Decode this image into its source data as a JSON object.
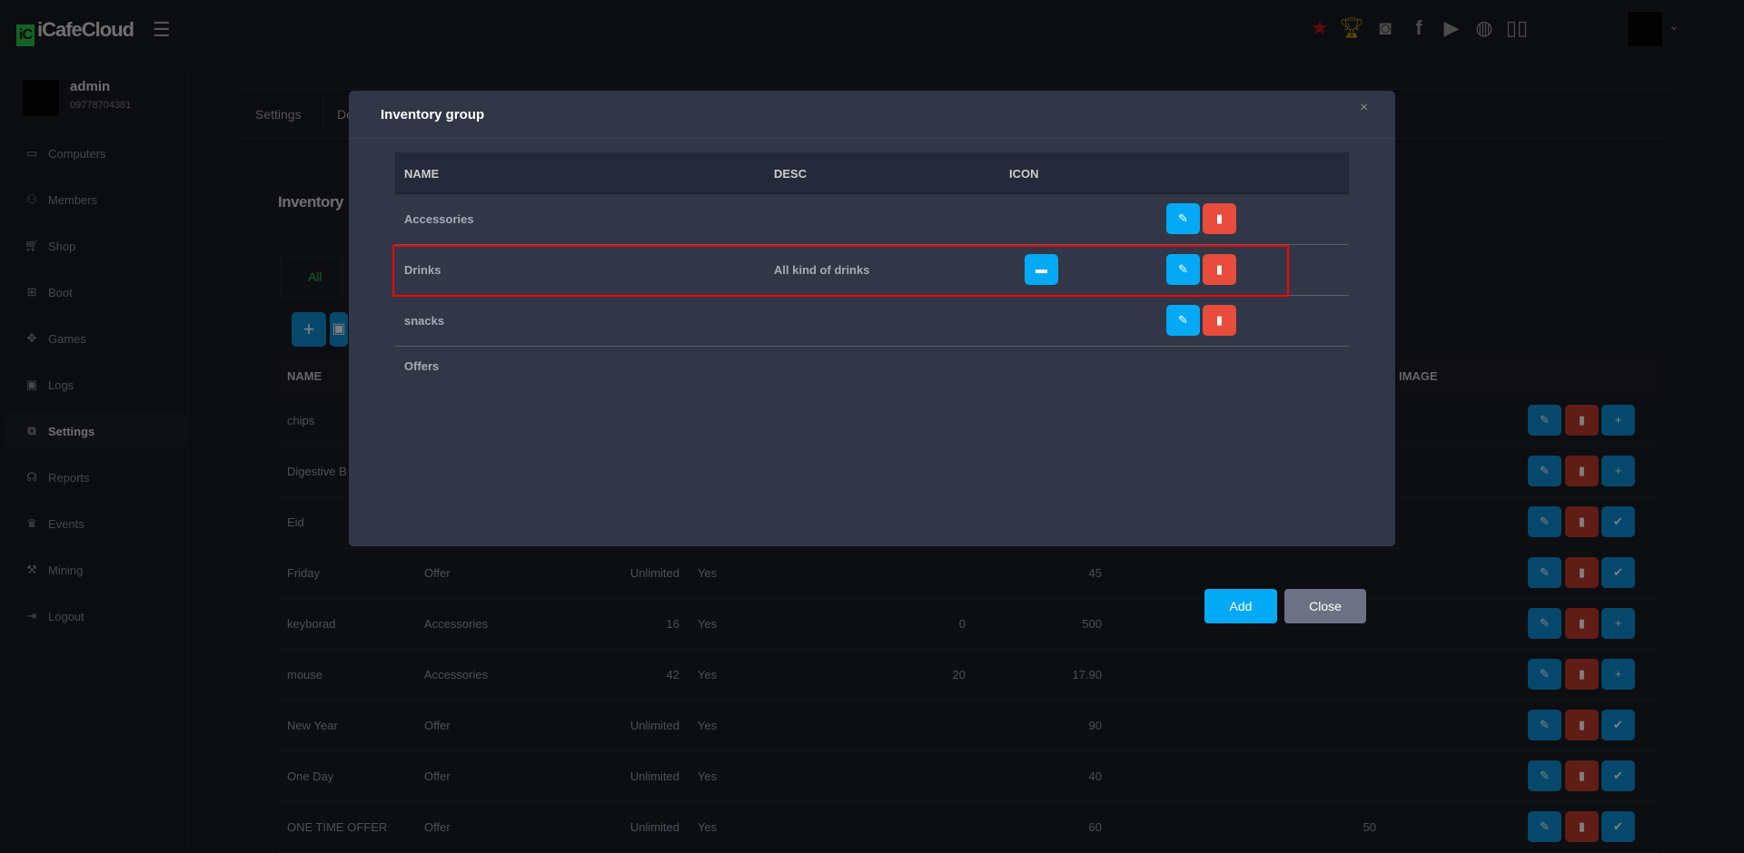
{
  "app": {
    "logo": "iCafeCloud",
    "logo_mark": "iC"
  },
  "topbar": {
    "icons": [
      "ranking-icon",
      "trophy-icon",
      "discord-icon",
      "facebook-icon",
      "youtube-icon",
      "globe-icon",
      "book-icon"
    ]
  },
  "user": {
    "name": "admin",
    "phone": "09778704381"
  },
  "sidebar": {
    "items": [
      {
        "label": "Computers",
        "icon": "monitor-icon"
      },
      {
        "label": "Members",
        "icon": "users-icon"
      },
      {
        "label": "Shop",
        "icon": "cart-icon"
      },
      {
        "label": "Boot",
        "icon": "windows-icon"
      },
      {
        "label": "Games",
        "icon": "gamepad-icon"
      },
      {
        "label": "Logs",
        "icon": "calendar-icon"
      },
      {
        "label": "Settings",
        "icon": "settings-icon",
        "active": true
      },
      {
        "label": "Reports",
        "icon": "reports-icon"
      },
      {
        "label": "Events",
        "icon": "crown-icon"
      },
      {
        "label": "Mining",
        "icon": "pickaxe-icon"
      },
      {
        "label": "Logout",
        "icon": "logout-icon"
      }
    ]
  },
  "page": {
    "tabs": [
      "Settings",
      "De"
    ],
    "title": "Inventory",
    "filter_tab": "All",
    "table": {
      "headers": {
        "name": "NAME",
        "image": "IMAGE"
      },
      "rows": [
        {
          "name": "chips",
          "action": "+"
        },
        {
          "name": "Digestive B",
          "action": "+"
        },
        {
          "name": "Eid",
          "action": "✔"
        },
        {
          "name": "Friday",
          "group": "Offer",
          "qty": "Unlimited",
          "active": "Yes",
          "cost": "",
          "price": "45",
          "extra": "",
          "action": "✔"
        },
        {
          "name": "keyborad",
          "group": "Accessories",
          "qty": "16",
          "active": "Yes",
          "cost": "0",
          "price": "500",
          "extra": "",
          "action": "+"
        },
        {
          "name": "mouse",
          "group": "Accessories",
          "qty": "42",
          "active": "Yes",
          "cost": "20",
          "price": "17.90",
          "extra": "",
          "action": "+"
        },
        {
          "name": "New Year",
          "group": "Offer",
          "qty": "Unlimited",
          "active": "Yes",
          "cost": "",
          "price": "90",
          "extra": "",
          "action": "✔"
        },
        {
          "name": "One Day",
          "group": "Offer",
          "qty": "Unlimited",
          "active": "Yes",
          "cost": "",
          "price": "40",
          "extra": "",
          "action": "✔"
        },
        {
          "name": "ONE TIME OFFER",
          "group": "Offer",
          "qty": "Unlimited",
          "active": "Yes",
          "cost": "",
          "price": "60",
          "extra": "50",
          "action": "✔"
        }
      ]
    }
  },
  "modal": {
    "title": "Inventory group",
    "close_x": "×",
    "headers": {
      "name": "NAME",
      "desc": "DESC",
      "icon": "ICON"
    },
    "rows": [
      {
        "name": "Accessories",
        "desc": "",
        "has_icon": false,
        "actions": true
      },
      {
        "name": "Drinks",
        "desc": "All kind of drinks",
        "has_icon": true,
        "actions": true,
        "highlighted": true
      },
      {
        "name": "snacks",
        "desc": "",
        "has_icon": false,
        "actions": true
      },
      {
        "name": "Offers",
        "desc": "",
        "has_icon": false,
        "actions": false
      }
    ],
    "add_label": "Add",
    "close_label": "Close"
  },
  "colors": {
    "accent": "#03a9f4",
    "danger": "#e74c3c",
    "highlight": "#ff0000",
    "brand": "#27c24c"
  }
}
